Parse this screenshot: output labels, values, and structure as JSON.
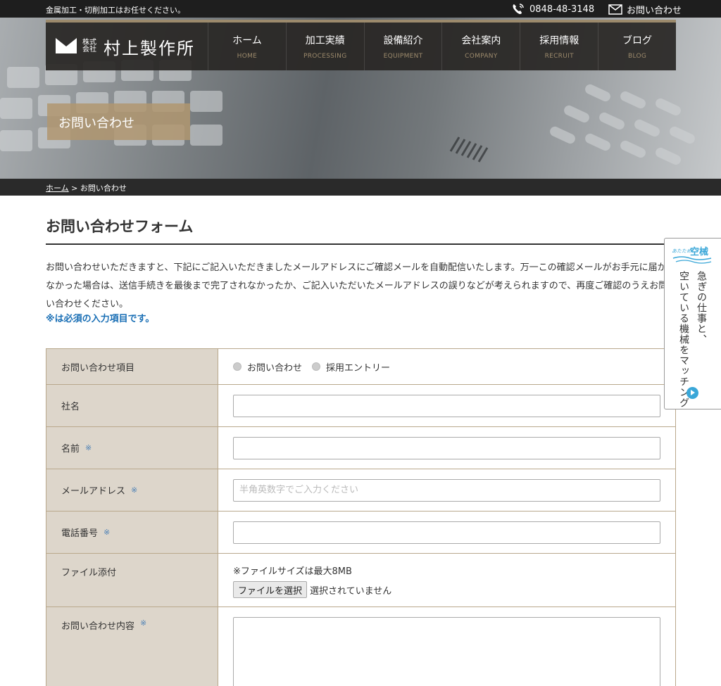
{
  "topbar": {
    "tagline": "金属加工・切削加工はお任せください。",
    "phone": "0848-48-3148",
    "contact": "お問い合わせ"
  },
  "logo": {
    "kabushiki": "株式会社",
    "name": "村上製作所"
  },
  "nav": [
    {
      "jp": "ホーム",
      "en": "HOME"
    },
    {
      "jp": "加工実績",
      "en": "PROCESSING"
    },
    {
      "jp": "設備紹介",
      "en": "EQUIPMENT"
    },
    {
      "jp": "会社案内",
      "en": "COMPANY"
    },
    {
      "jp": "採用情報",
      "en": "RECRUIT"
    },
    {
      "jp": "ブログ",
      "en": "BLOG"
    }
  ],
  "page_title": "お問い合わせ",
  "breadcrumb": {
    "home": "ホーム",
    "sep": ">",
    "current": "お問い合わせ"
  },
  "section_title": "お問い合わせフォーム",
  "intro": "お問い合わせいただきますと、下記にご記入いただきましたメールアドレスにご確認メールを自動配信いたします。万一この確認メールがお手元に届かなかった場合は、送信手続きを最後まで完了されなかったか、ご記入いただいたメールアドレスの誤りなどが考えられますので、再度ご確認のうえお問い合わせください。",
  "required_note": "※は必須の入力項目です。",
  "form": {
    "required_mark": "※",
    "inquiry_type": {
      "label": "お問い合わせ項目",
      "options": [
        "お問い合わせ",
        "採用エントリー"
      ]
    },
    "company": {
      "label": "社名",
      "value": ""
    },
    "name": {
      "label": "名前",
      "value": ""
    },
    "email": {
      "label": "メールアドレス",
      "placeholder": "半角英数字でご入力ください"
    },
    "phone": {
      "label": "電話番号",
      "value": ""
    },
    "file": {
      "label": "ファイル添付",
      "note": "※ファイルサイズは最大8MB",
      "button": "ファイルを選択",
      "status": "選択されていません"
    },
    "message": {
      "label": "お問い合わせ内容"
    }
  },
  "side_banner": {
    "brand_small": "あたため!",
    "brand": "空械",
    "line1": "急ぎの仕事と、",
    "line2": "空いている機械をマッチング"
  },
  "colors": {
    "accent": "#9c8a6c",
    "required_blue": "#1a6fb5",
    "label_bg": "#ddd6cb"
  }
}
